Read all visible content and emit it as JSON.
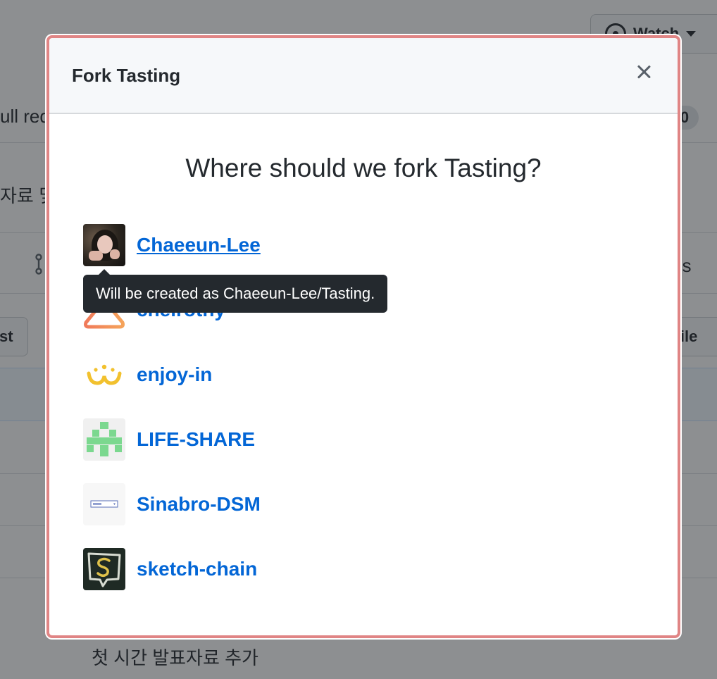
{
  "background": {
    "watch_label": "Watch",
    "pull_requests_fragment": "ull req",
    "counter": "0",
    "korean_fragment": "자료 및",
    "right_fragment": "es",
    "left_button_fragment": "st",
    "right_button_fragment": "d file",
    "commit_message": "첫 시간 발표자료 추가"
  },
  "modal": {
    "title": "Fork Tasting",
    "close_label": "Close",
    "question": "Where should we fork Tasting?",
    "tooltip": "Will be created as Chaeeun-Lee/Tasting.",
    "organizations": [
      {
        "name": "Chaeeun-Lee",
        "avatar": "user-photo-avatar"
      },
      {
        "name": "chelrothy",
        "avatar": "orange-hanger-logo"
      },
      {
        "name": "enjoy-in",
        "avatar": "yellow-crown-logo"
      },
      {
        "name": "LIFE-SHARE",
        "avatar": "green-identicon"
      },
      {
        "name": "Sinabro-DSM",
        "avatar": "dropdown-preview-logo"
      },
      {
        "name": "sketch-chain",
        "avatar": "chalk-s-speech-bubble-logo"
      }
    ]
  },
  "colors": {
    "link": "#0366d6",
    "modal_highlight_border": "#e08585",
    "tooltip_bg": "#24292e",
    "header_bg": "#f6f8fa"
  }
}
